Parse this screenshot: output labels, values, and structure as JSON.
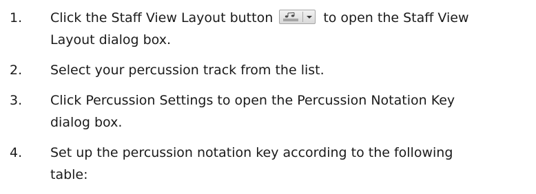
{
  "steps": [
    {
      "number": "1.",
      "line1_before": "Click the Staff View Layout button",
      "line1_after": "to open the Staff View",
      "line2": "Layout dialog box.",
      "button_icon": "staff-view-layout-icon"
    },
    {
      "number": "2.",
      "line1": "Select your percussion track from the list."
    },
    {
      "number": "3.",
      "line1": "Click Percussion Settings to open the Percussion Notation Key",
      "line2": "dialog box."
    },
    {
      "number": "4.",
      "line1": "Set up the percussion notation key according to the following",
      "line2": "table:"
    }
  ]
}
